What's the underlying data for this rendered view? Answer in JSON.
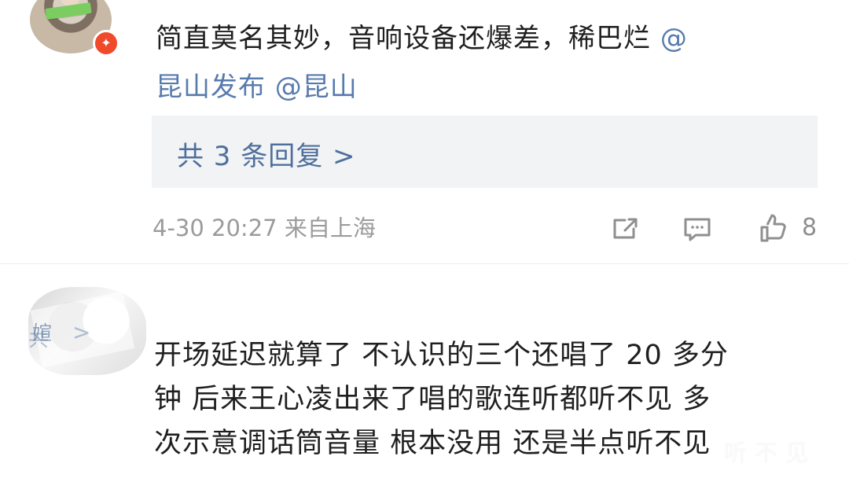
{
  "comments": [
    {
      "text_prefix": "简直莫名其妙，音响设备还爆差，稀巴烂",
      "mention_1": "@",
      "mention_2": "昆山发布 @昆山",
      "reply_text": "共 3 条回复 >",
      "meta": "4-30 20:27 来自上海",
      "likes": "8"
    },
    {
      "ghost_name_fragment": "媗",
      "ghost_chevron": ">",
      "ghost_side": "共",
      "lines": [
        "开场延迟就算了 不认识的三个还唱了 20 多分",
        "钟 后来王心凌出来了唱的歌连听都听不见 多",
        "次示意调话筒音量 根本没用 还是半点听不见"
      ],
      "watermark": "听不见"
    }
  ],
  "icons": {
    "repost": "repost-icon",
    "comment": "comment-icon",
    "like": "thumbs-up-icon",
    "badge": "verified-badge-icon"
  },
  "colors": {
    "link": "#587bad",
    "meta": "#9b9b9b",
    "reply_bg": "#f1f3f5",
    "badge": "#f04a2b"
  }
}
